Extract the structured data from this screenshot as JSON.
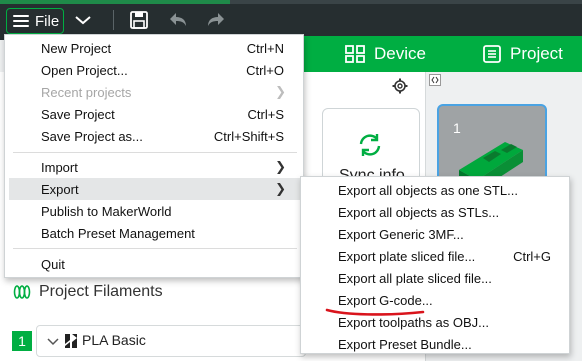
{
  "toolbar": {
    "file_label": "File"
  },
  "tabs": [
    {
      "label": "Device",
      "icon": "device-icon"
    },
    {
      "label": "Project",
      "icon": "project-icon"
    }
  ],
  "file_menu": {
    "items": [
      {
        "label": "New Project",
        "shortcut": "Ctrl+N"
      },
      {
        "label": "Open Project...",
        "shortcut": "Ctrl+O"
      },
      {
        "label": "Recent projects",
        "shortcut": "",
        "submenu": true,
        "disabled": true
      },
      {
        "label": "Save Project",
        "shortcut": "Ctrl+S"
      },
      {
        "label": "Save Project as...",
        "shortcut": "Ctrl+Shift+S"
      },
      {
        "label": "Import",
        "shortcut": "",
        "submenu": true
      },
      {
        "label": "Export",
        "shortcut": "",
        "submenu": true,
        "highlighted": true
      },
      {
        "label": "Publish to MakerWorld",
        "shortcut": ""
      },
      {
        "label": "Batch Preset Management",
        "shortcut": ""
      },
      {
        "label": "Quit",
        "shortcut": ""
      }
    ]
  },
  "export_menu": {
    "items": [
      {
        "label": "Export all objects as one STL...",
        "shortcut": ""
      },
      {
        "label": "Export all objects as STLs...",
        "shortcut": ""
      },
      {
        "label": "Export Generic 3MF...",
        "shortcut": ""
      },
      {
        "label": "Export plate sliced file...",
        "shortcut": "Ctrl+G"
      },
      {
        "label": "Export all plate sliced file...",
        "shortcut": ""
      },
      {
        "label": "Export G-code...",
        "shortcut": ""
      },
      {
        "label": "Export toolpaths as OBJ...",
        "shortcut": ""
      },
      {
        "label": "Export Preset Bundle...",
        "shortcut": ""
      }
    ]
  },
  "sidebar": {
    "sync_label": "Sync info",
    "project_filaments_label": "Project Filaments",
    "filament": {
      "index": "1",
      "name": "PLA Basic",
      "color": "#00ae42"
    }
  },
  "plate": {
    "number": "1"
  },
  "colors": {
    "accent": "#00ae42",
    "toolbar_bg": "#262e30",
    "annotation": "#d9141c"
  }
}
